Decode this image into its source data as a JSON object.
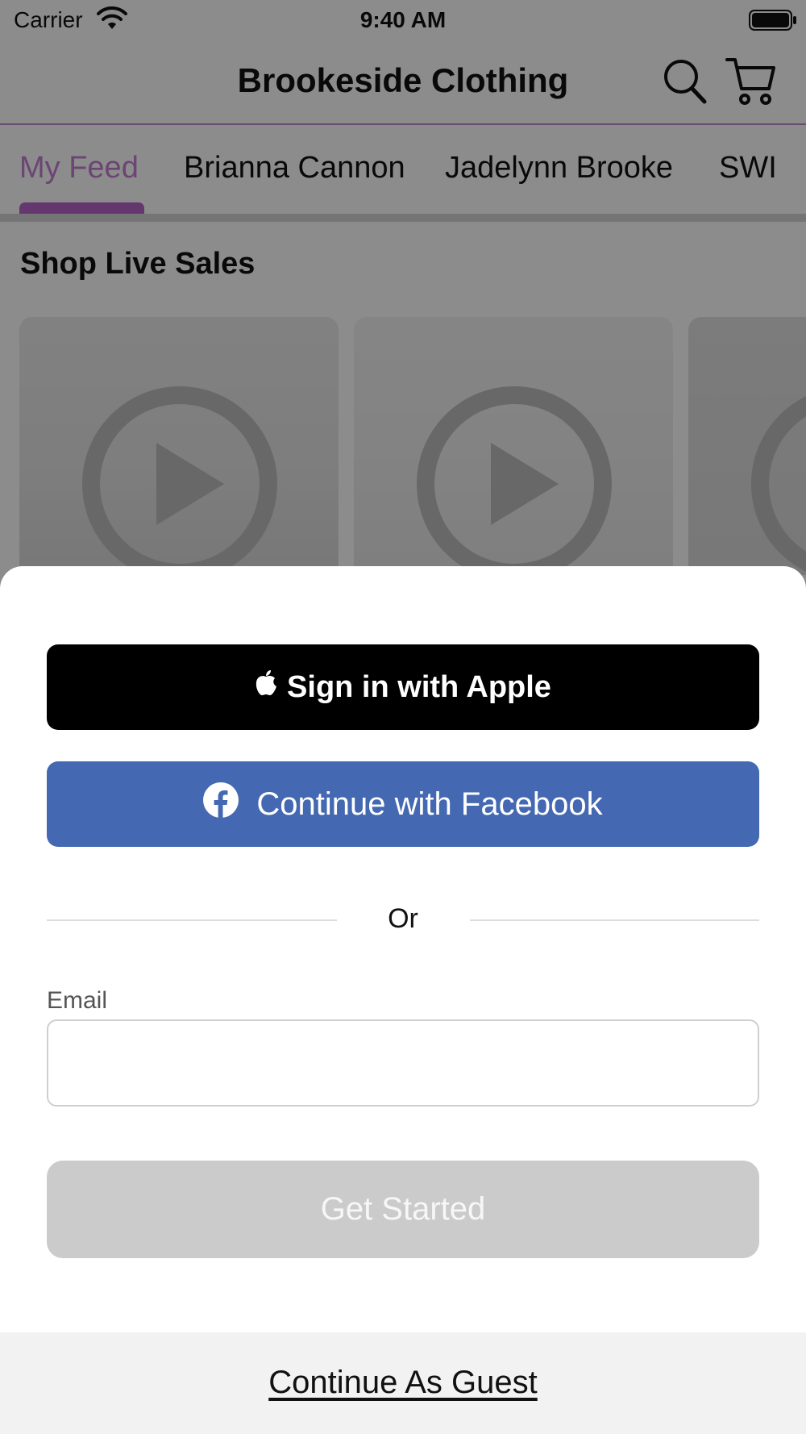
{
  "status_bar": {
    "carrier": "Carrier",
    "time": "9:40 AM"
  },
  "header": {
    "title": "Brookeside Clothing",
    "icons": [
      "search-icon",
      "cart-icon"
    ]
  },
  "tabs": [
    {
      "label": "My Feed",
      "active": true
    },
    {
      "label": "Brianna Cannon",
      "active": false
    },
    {
      "label": "Jadelynn Brooke",
      "active": false
    },
    {
      "label": "SWI",
      "active": false
    }
  ],
  "main": {
    "section_title": "Shop Live Sales",
    "video_cards": [
      {
        "icon": "play-icon"
      },
      {
        "icon": "play-icon"
      },
      {
        "icon": "play-icon"
      }
    ]
  },
  "sheet": {
    "apple_button": "Sign in with Apple",
    "facebook_button": "Continue with Facebook",
    "divider_text": "Or",
    "email_label": "Email",
    "email_value": "",
    "get_started_button": "Get Started",
    "guest_link": "Continue As Guest"
  },
  "colors": {
    "accent": "#b766c9",
    "facebook": "#4468b1",
    "apple": "#000000",
    "disabled_button": "#cbcbcb"
  }
}
